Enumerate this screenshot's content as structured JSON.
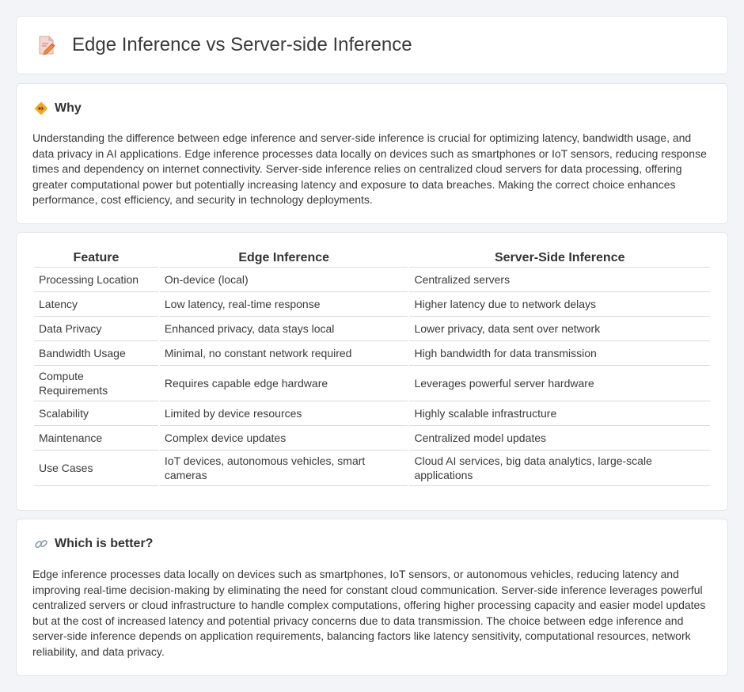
{
  "header": {
    "title": "Edge Inference vs Server-side Inference",
    "icon": "document-pencil-icon"
  },
  "why": {
    "icon": "diamond-sign-icon",
    "title": "Why",
    "text": "Understanding the difference between edge inference and server-side inference is crucial for optimizing latency, bandwidth usage, and data privacy in AI applications. Edge inference processes data locally on devices such as smartphones or IoT sensors, reducing response times and dependency on internet connectivity. Server-side inference relies on centralized cloud servers for data processing, offering greater computational power but potentially increasing latency and exposure to data breaches. Making the correct choice enhances performance, cost efficiency, and security in technology deployments."
  },
  "table": {
    "headers": [
      "Feature",
      "Edge Inference",
      "Server-Side Inference"
    ],
    "rows": [
      [
        "Processing Location",
        "On-device (local)",
        "Centralized servers"
      ],
      [
        "Latency",
        "Low latency, real-time response",
        "Higher latency due to network delays"
      ],
      [
        "Data Privacy",
        "Enhanced privacy, data stays local",
        "Lower privacy, data sent over network"
      ],
      [
        "Bandwidth Usage",
        "Minimal, no constant network required",
        "High bandwidth for data transmission"
      ],
      [
        "Compute Requirements",
        "Requires capable edge hardware",
        "Leverages powerful server hardware"
      ],
      [
        "Scalability",
        "Limited by device resources",
        "Highly scalable infrastructure"
      ],
      [
        "Maintenance",
        "Complex device updates",
        "Centralized model updates"
      ],
      [
        "Use Cases",
        "IoT devices, autonomous vehicles, smart cameras",
        "Cloud AI services, big data analytics, large-scale applications"
      ]
    ]
  },
  "better": {
    "icon": "link-icon",
    "title": "Which is better?",
    "text": "Edge inference processes data locally on devices such as smartphones, IoT sensors, or autonomous vehicles, reducing latency and improving real-time decision-making by eliminating the need for constant cloud communication. Server-side inference leverages powerful centralized servers or cloud infrastructure to handle complex computations, offering higher processing capacity and easier model updates but at the cost of increased latency and potential privacy concerns due to data transmission. The choice between edge inference and server-side inference depends on application requirements, balancing factors like latency sensitivity, computational resources, network reliability, and data privacy."
  }
}
